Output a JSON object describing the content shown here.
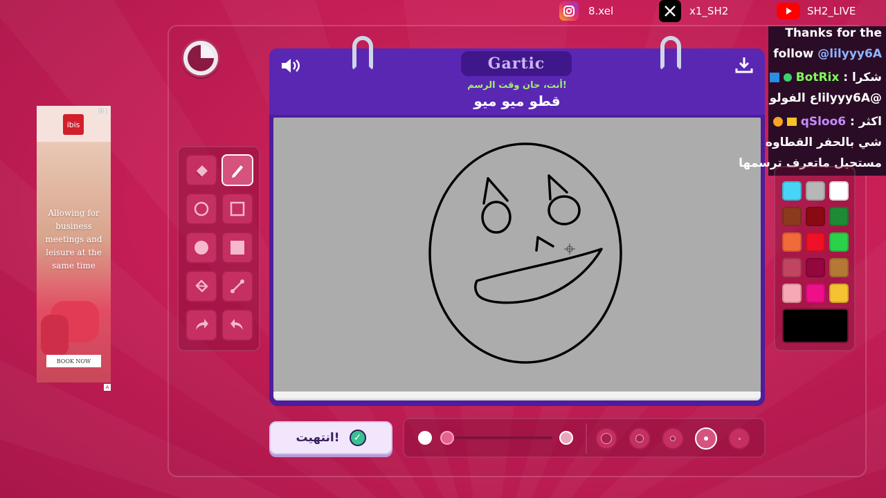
{
  "social": {
    "instagram": "8.xel",
    "x": "x1_SH2",
    "youtube": "SH2_LIVE"
  },
  "game": {
    "logo": "Gartic",
    "prompt": "أنت، حان وقت الرسم!",
    "word": "قطو ميو ميو",
    "done_label": "انتهيت!"
  },
  "ad": {
    "brand": "ibis",
    "text": "Allowing for business meetings and leisure at the same time",
    "cta": "BOOK NOW"
  },
  "chat": {
    "thanks_line1": "Thanks for the",
    "thanks_line2": "follow",
    "thanks_user": "@lilyyy6A",
    "line2_prefix": "شكرا :",
    "line2_user": "BotRix",
    "line3": "@lilyyy6Aع الفولو",
    "line4_prefix": "اكثر :",
    "line4_user": "qSloo6",
    "line5": "شي بالحفر القطاوه",
    "line6": "مستحيل ماتعرف ترسمها"
  },
  "palette": {
    "colors": [
      "#48d4f6",
      "#b7b7b7",
      "#ffffff",
      "#8c3a1e",
      "#8a0a13",
      "#1f8a35",
      "#f06a3a",
      "#ef1127",
      "#2bd148",
      "#c14560",
      "#93063e",
      "#b57835",
      "#f7a8b4",
      "#ef0f89",
      "#f5c232"
    ],
    "current": "#000000"
  },
  "tools": {
    "active": "pencil"
  },
  "brush": {
    "opacity_level": 0.0,
    "active_size_index": 3
  }
}
